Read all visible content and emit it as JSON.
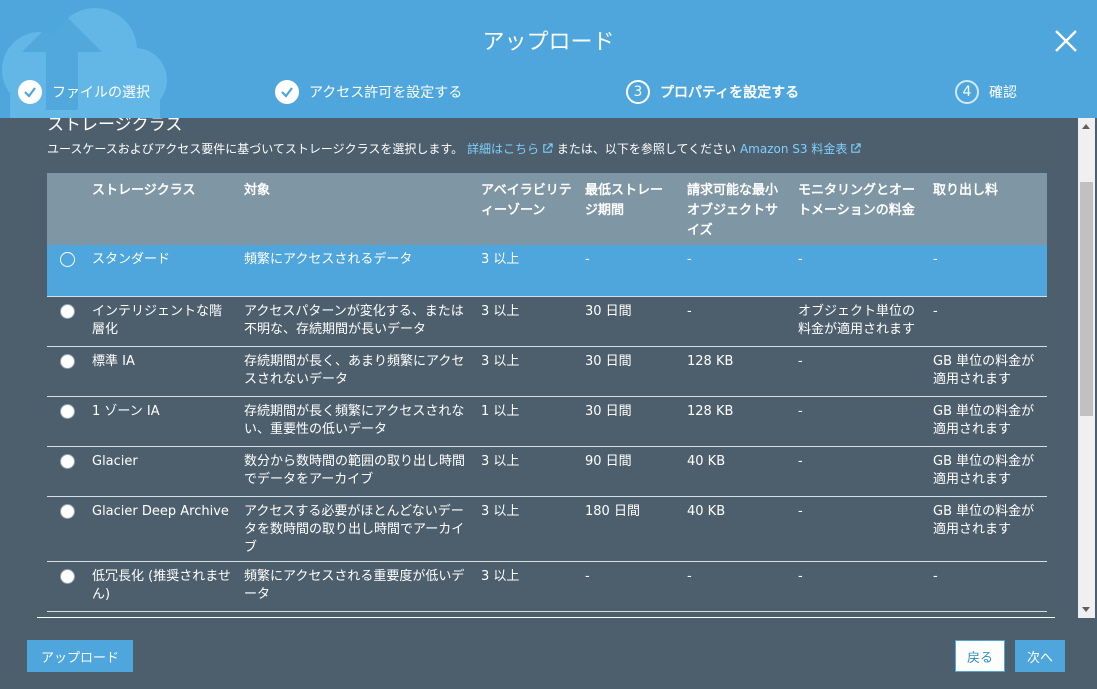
{
  "header": {
    "title": "アップロード",
    "steps": [
      {
        "number": "1",
        "label": "ファイルの選択",
        "state": "done"
      },
      {
        "number": "2",
        "label": "アクセス許可を設定する",
        "state": "done"
      },
      {
        "number": "3",
        "label": "プロパティを設定する",
        "state": "active"
      },
      {
        "number": "4",
        "label": "確認",
        "state": "pending"
      }
    ],
    "close_icon": "close-icon"
  },
  "section": {
    "title": "ストレージクラス",
    "description_before": "ユースケースおよびアクセス要件に基づいてストレージクラスを選択します。",
    "details_link": "詳細はこちら",
    "description_middle": "または、以下を参照してください",
    "pricing_link": "Amazon S3 料金表"
  },
  "table": {
    "headers": {
      "storage_class": "ストレージクラス",
      "target": "対象",
      "availability_zones": "アベイラビリティーゾーン",
      "min_storage_duration": "最低ストレージ期間",
      "min_billable_object_size": "請求可能な最小オブジェクトサイズ",
      "monitoring_fee": "モニタリングとオートメーションの料金",
      "retrieval_fee": "取り出し料"
    },
    "rows": [
      {
        "storage_class": "スタンダード",
        "target": "頻繁にアクセスされるデータ",
        "az": "3 以上",
        "min_duration": "-",
        "min_size": "-",
        "monitoring": "-",
        "retrieval": "-",
        "selected": true
      },
      {
        "storage_class": "インテリジェントな階層化",
        "target": "アクセスパターンが変化する、または不明な、存続期間が長いデータ",
        "az": "3 以上",
        "min_duration": "30 日間",
        "min_size": "-",
        "monitoring": "オブジェクト単位の料金が適用されます",
        "retrieval": "-",
        "selected": false
      },
      {
        "storage_class": "標準 IA",
        "target": "存続期間が長く、あまり頻繁にアクセスされないデータ",
        "az": "3 以上",
        "min_duration": "30 日間",
        "min_size": "128 KB",
        "monitoring": "-",
        "retrieval": "GB 単位の料金が適用されます",
        "selected": false
      },
      {
        "storage_class": "1 ゾーン IA",
        "target": "存続期間が長く頻繁にアクセスされない、重要性の低いデータ",
        "az": "1 以上",
        "min_duration": "30 日間",
        "min_size": "128 KB",
        "monitoring": "-",
        "retrieval": "GB 単位の料金が適用されます",
        "selected": false
      },
      {
        "storage_class": "Glacier",
        "target": "数分から数時間の範囲の取り出し時間でデータをアーカイブ",
        "az": "3 以上",
        "min_duration": "90 日間",
        "min_size": "40 KB",
        "monitoring": "-",
        "retrieval": "GB 単位の料金が適用されます",
        "selected": false
      },
      {
        "storage_class": "Glacier Deep Archive",
        "target": "アクセスする必要がほとんどないデータを数時間の取り出し時間でアーカイブ",
        "az": "3 以上",
        "min_duration": "180 日間",
        "min_size": "40 KB",
        "monitoring": "-",
        "retrieval": "GB 単位の料金が適用されます",
        "selected": false
      },
      {
        "storage_class": "低冗長化 (推奨されません)",
        "target": "頻繁にアクセスされる重要度が低いデータ",
        "az": "3 以上",
        "min_duration": "-",
        "min_size": "-",
        "monitoring": "-",
        "retrieval": "-",
        "selected": false
      }
    ]
  },
  "footer": {
    "upload_label": "アップロード",
    "back_label": "戻る",
    "next_label": "次へ"
  },
  "colors": {
    "accent": "#4ea6dc",
    "background": "#4d5f6c",
    "table_header": "#7f97a5",
    "link": "#7dd0ff"
  }
}
